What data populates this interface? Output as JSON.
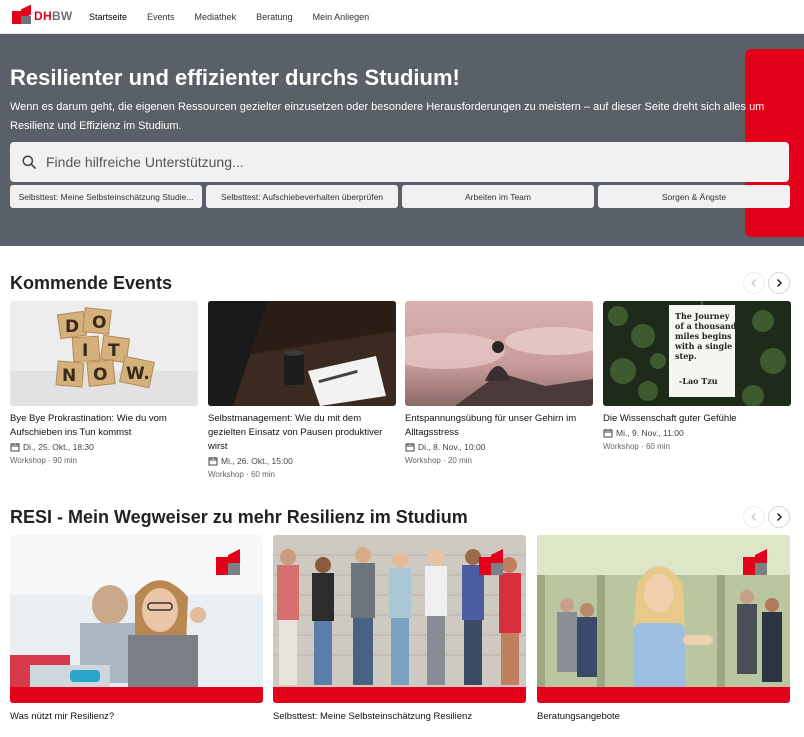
{
  "nav": {
    "logo_dh": "DH",
    "logo_bw": "BW",
    "links": [
      "Startseite",
      "Events",
      "Mediathek",
      "Beratung",
      "Mein Anliegen"
    ]
  },
  "hero": {
    "title": "Resilienter und effizienter durchs Studium!",
    "subtitle": "Wenn es darum geht, die eigenen Ressourcen gezielter einzusetzen oder besondere Herausforderungen zu meistern – auf dieser Seite dreht sich alles um Resilienz und Effizienz im Studium.",
    "search_placeholder": "Finde hilfreiche Unterstützung...",
    "chips": [
      "Selbsttest: Meine Selbsteinschätzung Studie...",
      "Selbsttest: Aufschiebeverhalten überprüfen",
      "Arbeiten im Team",
      "Sorgen & Ängste"
    ]
  },
  "events": {
    "title": "Kommende Events",
    "items": [
      {
        "title": "Bye Bye Prokrastination: Wie du vom Aufschieben ins Tun kommst",
        "date": "Di., 25. Okt., 18:30",
        "meta": "Workshop · 90 min",
        "image": "scrabble-tiles-do-it-now"
      },
      {
        "title": "Selbstmanagement: Wie du mit dem gezielten Einsatz von Pausen produktiver wirst",
        "date": "Mi., 26. Okt., 15:00",
        "meta": "Workshop · 60 min",
        "image": "desk-coffee-cup-notebook"
      },
      {
        "title": "Entspannungsübung für unser Gehirn im Alltagsstress",
        "date": "Di., 8. Nov., 10:00",
        "meta": "Workshop · 20 min",
        "image": "person-sitting-above-clouds"
      },
      {
        "title": "Die Wissenschaft guter Gefühle",
        "date": "Mi., 9. Nov., 11:00",
        "meta": "Workshop · 60 min",
        "image": "quote-sign-on-ivy",
        "quote_lines": [
          "The Journey",
          "of a thousand",
          "miles begins",
          "with a single",
          "step.",
          "-Lao Tzu"
        ]
      }
    ]
  },
  "resi": {
    "title": "RESI - Mein Wegweiser zu mehr Resilienz im Studium",
    "items": [
      {
        "title": "Was nützt mir Resilienz?",
        "image": "student-thumbs-up-at-laptop"
      },
      {
        "title": "Selbsttest: Meine Selbsteinschätzung Resilienz",
        "image": "group-of-students-with-phones"
      },
      {
        "title": "Beratungsangebote",
        "image": "smiling-student-in-hall"
      }
    ]
  },
  "colors": {
    "brand_red": "#e2001a",
    "hero_bg": "#5a6068",
    "brand_gray": "#6d7278"
  },
  "icons": {
    "search": "search-icon",
    "calendar": "calendar-icon",
    "prev": "chevron-left-icon",
    "next": "chevron-right-icon"
  }
}
